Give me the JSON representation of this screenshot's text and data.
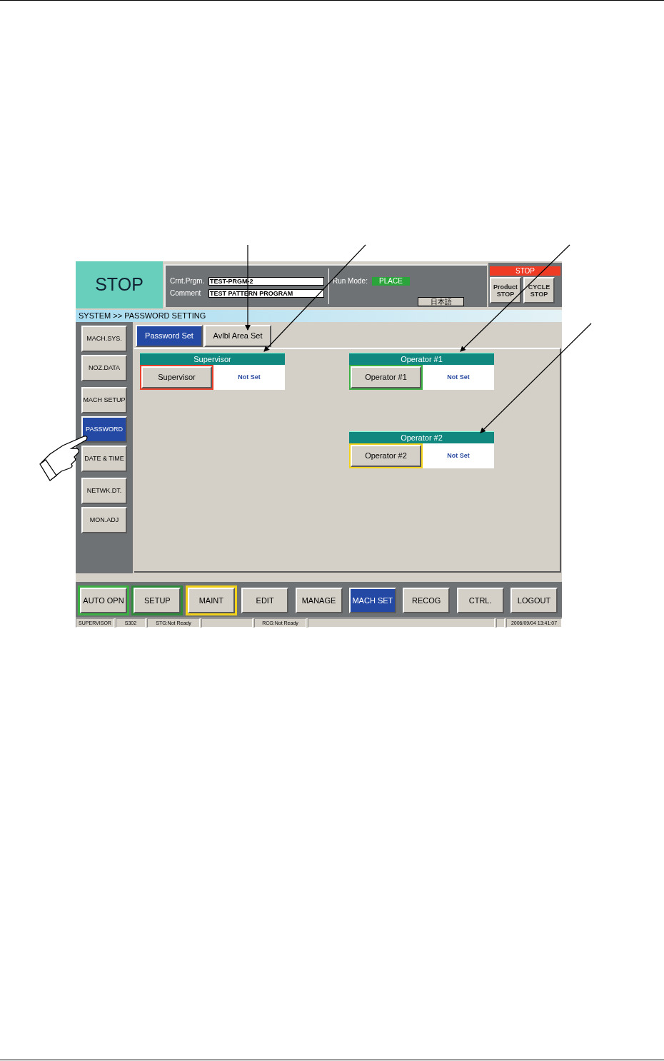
{
  "header": {
    "status": "STOP",
    "program": [
      {
        "label": "Crnt.Prgm.",
        "value": "TEST-PRGM-2"
      },
      {
        "label": "Comment",
        "value": "TEST PATTERN PROGRAM"
      }
    ],
    "run_mode": {
      "label": "Run Mode:",
      "value": "PLACE"
    },
    "language_button": "日本語",
    "stop_panel": {
      "title": "STOP",
      "buttons": [
        "Product STOP",
        "CYCLE STOP"
      ]
    }
  },
  "breadcrumb": "SYSTEM >> PASSWORD SETTING",
  "sidebar": {
    "groups": [
      {
        "items": [
          {
            "label": "MACH.SYS.",
            "selected": false
          },
          {
            "label": "NOZ.DATA",
            "selected": false
          }
        ]
      },
      {
        "items": [
          {
            "label": "MACH SETUP",
            "selected": false
          },
          {
            "label": "PASSWORD",
            "selected": true
          },
          {
            "label": "DATE & TIME",
            "selected": false
          }
        ]
      },
      {
        "items": [
          {
            "label": "NETWK.DT.",
            "selected": false
          },
          {
            "label": "MON.ADJ",
            "selected": false
          }
        ]
      }
    ]
  },
  "tabs": [
    {
      "label": "Password Set",
      "selected": true
    },
    {
      "label": "Avlbl Area Set",
      "selected": false
    }
  ],
  "card_rows": [
    {
      "cards": [
        {
          "kind": "group",
          "title": "Supervisor",
          "button": "Supervisor",
          "color": "#e8402a",
          "status": "Not Set"
        },
        {
          "kind": "group",
          "title": "Operator #1",
          "button": "Operator #1",
          "color": "#3cb043",
          "status": "Not Set"
        }
      ]
    },
    {
      "cards": [
        {
          "kind": "empty"
        },
        {
          "kind": "group",
          "title": "Operator #2",
          "button": "Operator #2",
          "color": "#f2d21b",
          "status": "Not Set"
        }
      ]
    }
  ],
  "bottom_buttons": [
    {
      "label": "AUTO OPN",
      "color": "#3cb043",
      "selected": false
    },
    {
      "label": "SETUP",
      "color": "#2e8b3a",
      "selected": false
    },
    {
      "label": "MAINT",
      "color": "#f2d21b",
      "selected": false
    },
    {
      "label": "EDIT",
      "selected": false
    },
    {
      "label": "MANAGE",
      "selected": false
    },
    {
      "label": "MACH SET",
      "selected": true
    },
    {
      "label": "RECOG",
      "selected": false
    },
    {
      "label": "CTRL.",
      "selected": false
    },
    {
      "label": "LOGOUT",
      "selected": false
    }
  ],
  "status_bar": [
    {
      "kind": "text",
      "text": "SUPERVISOR"
    },
    {
      "kind": "text",
      "text": "S302"
    },
    {
      "kind": "text",
      "text": "STG:Not Ready"
    },
    {
      "kind": "blank"
    },
    {
      "kind": "text",
      "text": "RCG:Not Ready"
    },
    {
      "kind": "blank"
    },
    {
      "kind": "blank"
    },
    {
      "kind": "text",
      "text": "2006/09/04 13:41:07"
    }
  ]
}
